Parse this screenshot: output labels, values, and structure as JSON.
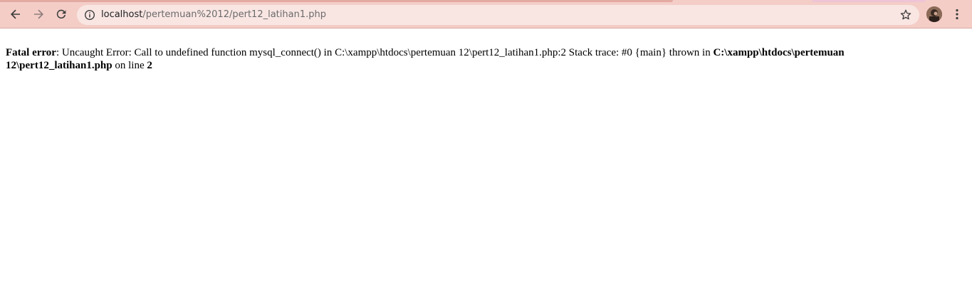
{
  "browser": {
    "url_host": "localhost",
    "url_path": "/pertemuan%2012/pert12_latihan1.php",
    "back_icon": "back-arrow-icon",
    "forward_icon": "forward-arrow-icon",
    "reload_icon": "reload-icon",
    "site_info_icon": "info-icon",
    "bookmark_icon": "star-icon",
    "menu_icon": "kebab-menu-icon",
    "toolbar_color": "#f4cdc7",
    "omnibox_color": "#f9e6e3"
  },
  "error": {
    "label": "Fatal error",
    "message": ": Uncaught Error: Call to undefined function mysql_connect() in C:\\xampp\\htdocs\\pertemuan 12\\pert12_latihan1.php:2 Stack trace: #0 {main} thrown in ",
    "file": "C:\\xampp\\htdocs\\pertemuan 12\\pert12_latihan1.php",
    "on_line_text": " on line ",
    "line": "2"
  }
}
